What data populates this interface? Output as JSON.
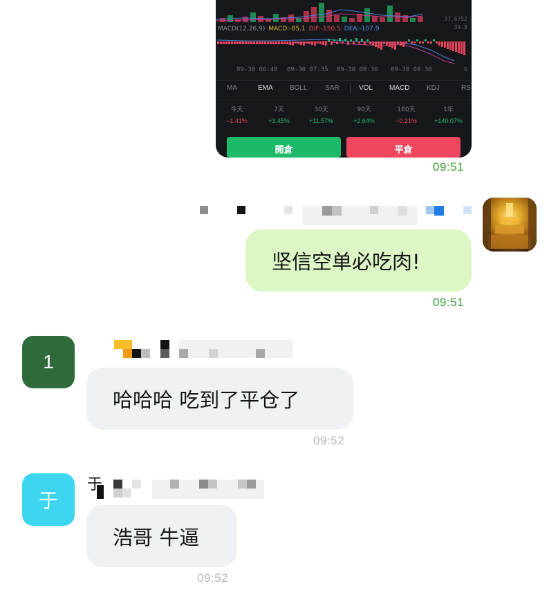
{
  "trade_card": {
    "price_high": "37.6752",
    "price_low": "34.8",
    "macd_legend": {
      "macd": "MACD(12,26,9)",
      "macd_value": "MACD:-85.1",
      "dif": "DIF:-150.5",
      "dea": "DEA:-107.9"
    },
    "macd_zero": "0",
    "times": [
      "09-30 06:40",
      "09-30 07:35",
      "09-30 08:30",
      "09-30 09:30"
    ],
    "indicator_tabs": [
      "MA",
      "EMA",
      "BOLL",
      "SAR",
      "VOL",
      "MACD",
      "KDJ",
      "RS"
    ],
    "periods": [
      {
        "name": "今天",
        "value": "−1.41%",
        "color": "#e8455b"
      },
      {
        "name": "7天",
        "value": "+3.45%",
        "color": "#22b66c"
      },
      {
        "name": "30天",
        "value": "+11.57%",
        "color": "#22b66c"
      },
      {
        "name": "90天",
        "value": "+2.64%",
        "color": "#22b66c"
      },
      {
        "name": "180天",
        "value": "−0.21%",
        "color": "#e8455b"
      },
      {
        "name": "1年",
        "value": "+140.07%",
        "color": "#22b66c"
      }
    ],
    "open_button": "開倉",
    "close_button": "平倉"
  },
  "messages": [
    {
      "time": "09:51"
    },
    {
      "text": "坚信空单必吃肉!",
      "time": "09:51"
    },
    {
      "avatar_letter": "1",
      "text": "哈哈哈 吃到了平仓了",
      "time": "09:52"
    },
    {
      "avatar_letter": "于",
      "sender_glyph": "于",
      "text": "浩哥 牛逼",
      "time": "09:52"
    }
  ],
  "colors": {
    "out_bubble": "#dcf6c6",
    "in_bubble": "#f0f1f5",
    "time_green": "#3aa02f",
    "time_gray": "#b3b6bc",
    "avatar_1": "#2e6a3a",
    "avatar_yu": "#3dd6ef"
  }
}
